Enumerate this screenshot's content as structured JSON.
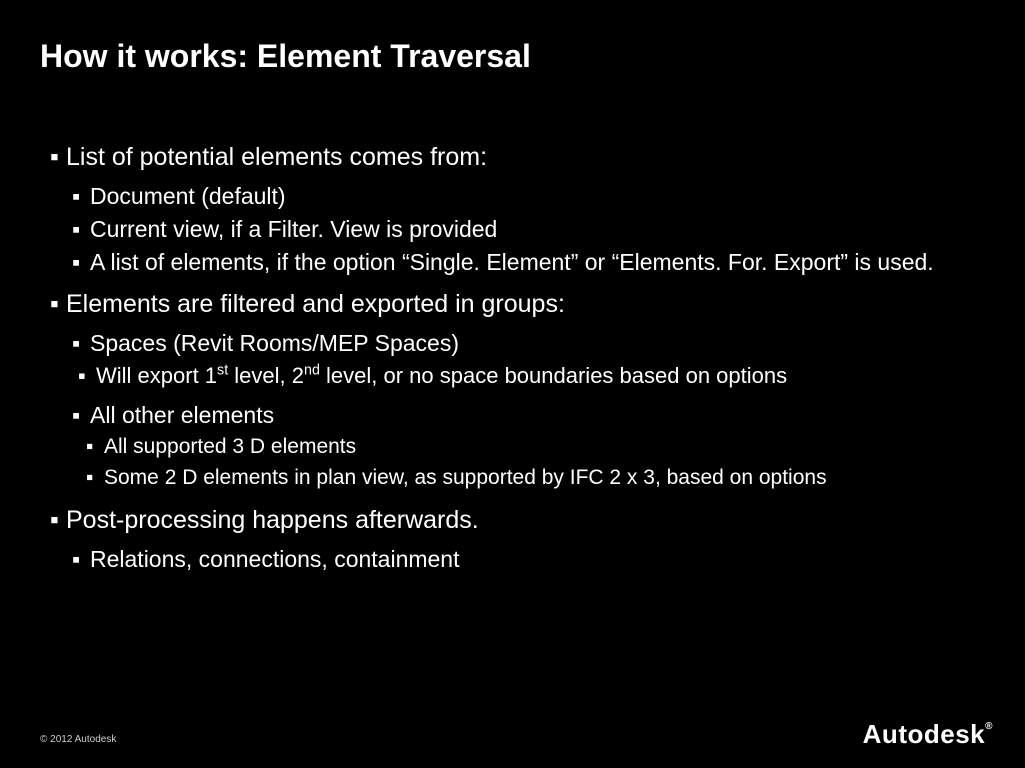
{
  "title": "How it works: Element Traversal",
  "items": [
    {
      "text": "List of potential elements comes from:",
      "children": [
        {
          "text": "Document (default)"
        },
        {
          "text": "Current view, if a Filter. View is provided"
        },
        {
          "text": "A list of elements, if the option “Single. Element” or “Elements. For. Export” is used."
        }
      ]
    },
    {
      "text": "Elements are filtered and exported in groups:",
      "children": [
        {
          "text": "Spaces (Revit Rooms/MEP Spaces)",
          "children": [
            {
              "text_html": "Will export 1<sup class=\"ord\">st</sup> level, 2<sup class=\"ord\">nd</sup> level, or no space boundaries based on options"
            }
          ]
        },
        {
          "text": "All other elements",
          "children": [
            {
              "text": "All supported 3 D elements"
            },
            {
              "text": "Some 2 D elements in plan view, as supported by IFC 2 x 3, based on options"
            }
          ]
        }
      ]
    },
    {
      "text": "Post-processing happens afterwards.",
      "children": [
        {
          "text": "Relations, connections, containment"
        }
      ]
    }
  ],
  "footer": "© 2012 Autodesk",
  "logo": "Autodesk",
  "glyph": "▪"
}
